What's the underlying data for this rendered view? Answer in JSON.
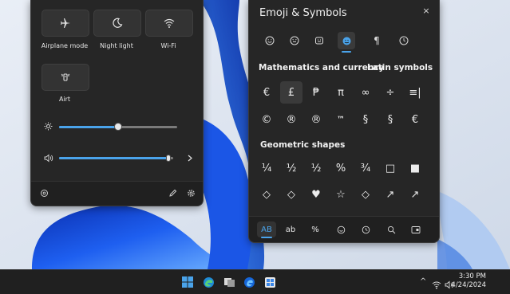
{
  "quick_settings": {
    "tiles": [
      {
        "label": "Airplane mode",
        "icon": "airplane-icon"
      },
      {
        "label": "Night light",
        "icon": "moon-icon"
      },
      {
        "label": "Wi-Fi",
        "icon": "wifi-icon"
      },
      {
        "label": "Airt",
        "icon": "flashlight-icon"
      }
    ],
    "brightness": {
      "icon": "sun-icon",
      "level": 0.5
    },
    "volume": {
      "icon": "speaker-icon",
      "level": 0.97,
      "expand_icon": "chevron-right-icon"
    },
    "footer_icons": [
      "settings-outline-icon",
      "pencil-icon",
      "gear-icon"
    ]
  },
  "emoji_panel": {
    "title": "Emoji & Symbols",
    "close_label": "×",
    "category_icons": [
      "smiley-icon",
      "kaomoji-icon",
      "gif-icon",
      "emoji-face-icon",
      "pilcrow-icon",
      "clock-icon"
    ],
    "active_category": 3,
    "sections": [
      {
        "heading": "Mathematics and currency",
        "secondary": "Latin symbols"
      },
      {
        "heading": "Geometric shapes"
      }
    ],
    "row1": [
      "€",
      "£",
      "₱",
      "π",
      "∞",
      "÷",
      "≡|"
    ],
    "row2": [
      "©",
      "®",
      "®",
      "™",
      "§",
      "§",
      "€"
    ],
    "row3": [
      "¼",
      "½",
      "½",
      "%",
      "¾",
      "□",
      "■"
    ],
    "row4": [
      "◇",
      "◇",
      "♥",
      "☆",
      "◇",
      "↗",
      "↗"
    ],
    "bottom_tabs": [
      "AB",
      "ab",
      "%",
      "emoji-icon",
      "clock-icon",
      "search-icon",
      "window-icon"
    ],
    "active_bottom_tab": 0
  },
  "taskbar": {
    "icons": [
      "windows-start-icon",
      "edge-icon",
      "taskview-icon",
      "edge-blue-icon",
      "store-icon"
    ],
    "tray": {
      "chevron": "^",
      "wifi": "wifi-icon",
      "volume": "speaker-icon"
    },
    "time": "3:30 PM",
    "date": "4/24/2024"
  },
  "colors": {
    "accent": "#4aa3ea",
    "panel": "#262626",
    "taskbar": "#202020"
  }
}
